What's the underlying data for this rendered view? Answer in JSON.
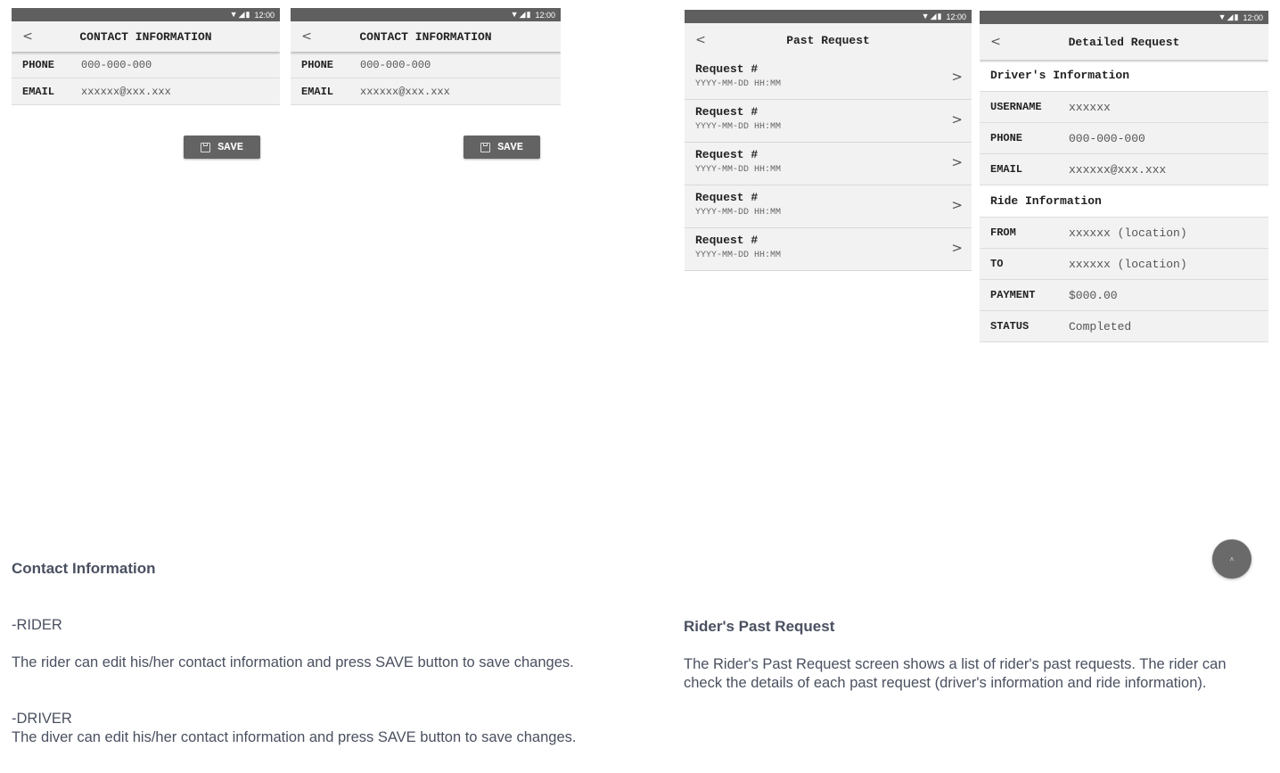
{
  "status_bar": {
    "icons": "▼◢▮",
    "time": "12:00"
  },
  "contact_screen": {
    "title": "CONTACT INFORMATION",
    "back": "<",
    "fields": [
      {
        "label": "PHONE",
        "value": "000-000-000"
      },
      {
        "label": "EMAIL",
        "value": "xxxxxx@xxx.xxx"
      }
    ],
    "save_label": "SAVE"
  },
  "past_request_screen": {
    "title": "Past Request",
    "back": "<",
    "items": [
      {
        "title": "Request #",
        "date": "YYYY-MM-DD HH:MM"
      },
      {
        "title": "Request #",
        "date": "YYYY-MM-DD HH:MM"
      },
      {
        "title": "Request #",
        "date": "YYYY-MM-DD HH:MM"
      },
      {
        "title": "Request #",
        "date": "YYYY-MM-DD HH:MM"
      },
      {
        "title": "Request #",
        "date": "YYYY-MM-DD HH:MM"
      }
    ],
    "chevron": ">"
  },
  "detailed_screen": {
    "title": "Detailed Request",
    "back": "<",
    "driver_heading": "Driver's Information",
    "driver_rows": [
      {
        "label": "USERNAME",
        "value": "xxxxxx"
      },
      {
        "label": "PHONE",
        "value": "000-000-000"
      },
      {
        "label": "EMAIL",
        "value": "xxxxxx@xxx.xxx"
      }
    ],
    "ride_heading": "Ride Information",
    "ride_rows": [
      {
        "label": "FROM",
        "value": "xxxxxx (location)"
      },
      {
        "label": "TO",
        "value": "xxxxxx (location)"
      },
      {
        "label": "PAYMENT",
        "value": "$000.00"
      },
      {
        "label": "STATUS",
        "value": "Completed"
      }
    ]
  },
  "contact_section": {
    "heading": "Contact Information",
    "rider_tag": "-RIDER",
    "rider_text": "The rider can edit his/her contact information and press SAVE button to save changes.",
    "driver_tag": "-DRIVER",
    "driver_text": "The diver can edit his/her contact information and press SAVE button to save changes."
  },
  "past_section": {
    "heading": "Rider's Past Request",
    "text": "The Rider's Past Request screen shows a list of rider's past requests. The rider can check the details of each past request (driver's information and ride information)."
  },
  "fab": {
    "icon": "˄",
    "icon_name": "scroll-up-icon"
  }
}
